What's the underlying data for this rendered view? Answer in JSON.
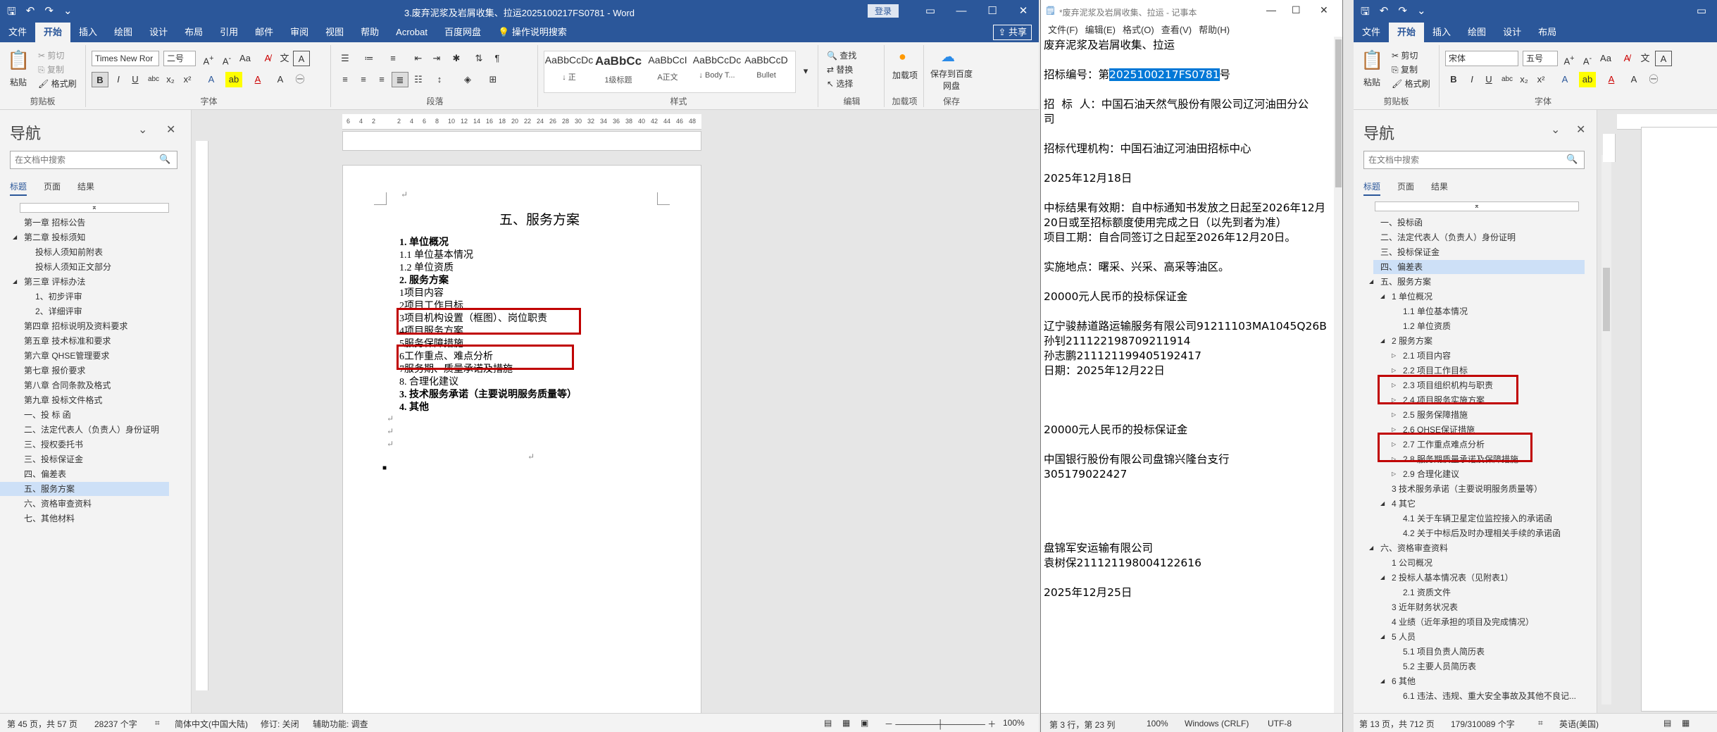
{
  "word1": {
    "title": "3.废弃泥浆及岩屑收集、拉运2025100217FS0781 - Word",
    "login": "登录",
    "tabs": [
      "文件",
      "开始",
      "插入",
      "绘图",
      "设计",
      "布局",
      "引用",
      "邮件",
      "审阅",
      "视图",
      "帮助",
      "Acrobat",
      "百度网盘",
      "操作说明搜索"
    ],
    "share": "共享",
    "clipboard": {
      "paste": "粘贴",
      "cut": "剪切",
      "copy": "复制",
      "painter": "格式刷",
      "group": "剪贴板"
    },
    "font": {
      "name": "Times New Ror",
      "size": "二号",
      "group": "字体"
    },
    "paragraph": {
      "group": "段落"
    },
    "styles": {
      "items": [
        {
          "preview": "AaBbCcDc",
          "name": "↓ 正"
        },
        {
          "preview": "AaBbCc",
          "name": "1级标题"
        },
        {
          "preview": "AaBbCcI",
          "name": "A正文"
        },
        {
          "preview": "AaBbCcDc",
          "name": "↓ Body T..."
        },
        {
          "preview": "AaBbCcD",
          "name": "Bullet"
        }
      ],
      "group": "样式"
    },
    "editing": {
      "find": "查找",
      "replace": "替换",
      "select": "选择",
      "group": "编辑"
    },
    "addins": {
      "load": "加载项",
      "group": "加载项"
    },
    "save": {
      "label": "保存到百度网盘",
      "group": "保存"
    },
    "nav": {
      "title": "导航",
      "search_placeholder": "在文档中搜索",
      "tabs": [
        "标题",
        "页面",
        "结果"
      ],
      "items": [
        "第一章  招标公告",
        "第二章  投标须知",
        "投标人须知前附表",
        "投标人须知正文部分",
        "第三章  评标办法",
        "1、初步评审",
        "2、详细评审",
        "第四章  招标说明及资料要求",
        "第五章  技术标准和要求",
        "第六章  QHSE管理要求",
        "第七章  报价要求",
        "第八章  合同条款及格式",
        "第九章  投标文件格式",
        "一、投 标 函",
        "二、法定代表人（负责人）身份证明",
        "三、授权委托书",
        "三、投标保证金",
        "四、偏差表",
        "五、服务方案",
        "六、资格审查资料",
        "七、其他材料"
      ]
    },
    "ruler": [
      "6",
      "4",
      "2",
      "",
      "2",
      "4",
      "6",
      "8",
      "10",
      "12",
      "14",
      "16",
      "18",
      "20",
      "22",
      "24",
      "26",
      "28",
      "30",
      "32",
      "34",
      "36",
      "38",
      "40",
      "42",
      "44",
      "46",
      "48"
    ],
    "doc": {
      "heading": "五、服务方案",
      "lines": [
        "1. 单位概况",
        "1.1 单位基本情况",
        "1.2 单位资质",
        "2. 服务方案",
        "1项目内容",
        "2项目工作目标",
        "3项目机构设置（框图）、岗位职责",
        "4项目服务方案",
        "5服务保障措施",
        "6工作重点、难点分析",
        "7服务期、质量承诺及措施",
        "8. 合理化建议",
        "3. 技术服务承诺（主要说明服务质量等）",
        "4. 其他"
      ]
    },
    "status": {
      "page": "第 45 页，共 57 页",
      "words": "28237 个字",
      "lang": "简体中文(中国大陆)",
      "track": "修订: 关闭",
      "access": "辅助功能: 调查",
      "zoom": "100%"
    }
  },
  "notepad": {
    "title": "*废弃泥浆及岩屑收集、拉运 - 记事本",
    "menu": [
      "文件(F)",
      "编辑(E)",
      "格式(O)",
      "查看(V)",
      "帮助(H)"
    ],
    "line1": "废弃泥浆及岩屑收集、拉运",
    "line2_pre": "招标编号：第",
    "line2_sel": "2025100217FS0781",
    "line2_post": "号",
    "body": "招  标  人：中国石油天然气股份有限公司辽河油田分公\n司\n\n招标代理机构：中国石油辽河油田招标中心\n\n2025年12月18日\n\n中标结果有效期：自中标通知书发放之日起至2026年12月\n20日或至招标额度使用完成之日（以先到者为准）\n项目工期：自合同签订之日起至2026年12月20日。\n\n实施地点：曙采、兴采、高采等油区。\n\n20000元人民币的投标保证金\n\n辽宁骏赫道路运输服务有限公司91211103MA1045Q26B\n孙钊211122198709211914\n孙志鹏211121199405192417\n日期：2025年12月22日\n\n\n\n20000元人民币的投标保证金\n\n中国银行股份有限公司盘锦兴隆台支行\n305179022427\n\n\n\n\n盘锦军安运输有限公司\n袁树保211121198004122616\n\n2025年12月25日",
    "status": {
      "pos": "第 3 行，第 23 列",
      "zoom": "100%",
      "eol": "Windows (CRLF)",
      "enc": "UTF-8"
    }
  },
  "word2": {
    "tabs": [
      "文件",
      "开始",
      "插入",
      "绘图",
      "设计",
      "布局"
    ],
    "clipboard": {
      "paste": "粘贴",
      "cut": "剪切",
      "copy": "复制",
      "painter": "格式刷",
      "group": "剪贴板"
    },
    "font": {
      "name": "宋体",
      "size": "五号",
      "group": "字体"
    },
    "nav": {
      "title": "导航",
      "search_placeholder": "在文档中搜索",
      "tabs": [
        "标题",
        "页面",
        "结果"
      ],
      "items": [
        "一、投标函",
        "二、法定代表人（负责人）身份证明",
        "三、投标保证金",
        "四、偏差表",
        "五、服务方案",
        "1 单位概况",
        "1.1 单位基本情况",
        "1.2 单位资质",
        "2 服务方案",
        "2.1 项目内容",
        "2.2 项目工作目标",
        "2.3 项目组织机构与职责",
        "2.4 项目服务实施方案",
        "2.5 服务保障措施",
        "2.6 QHSE保证措施",
        "2.7 工作重点难点分析",
        "2.8 服务期质量承诺及保障措施",
        "2.9 合理化建议",
        "3 技术服务承诺（主要说明服务质量等）",
        "4 其它",
        "4.1 关于车辆卫星定位监控接入的承诺函",
        "4.2 关于中标后及时办理相关手续的承诺函",
        "六、资格审查资料",
        "1 公司概况",
        "2 投标人基本情况表（见附表1）",
        "2.1 资质文件",
        "3 近年财务状况表",
        "4 业绩（近年承担的项目及完成情况）",
        "5 人员",
        "5.1 项目负责人简历表",
        "5.2 主要人员简历表",
        "6 其他",
        "6.1 违法、违规、重大安全事故及其他不良记..."
      ]
    },
    "status": {
      "page": "第 13 页，共 712 页",
      "words": "179/310089 个字",
      "lang": "英语(美国)"
    }
  },
  "colors": {
    "word_blue": "#2b579a",
    "red_box": "#c00000",
    "selection": "#0078d7"
  }
}
